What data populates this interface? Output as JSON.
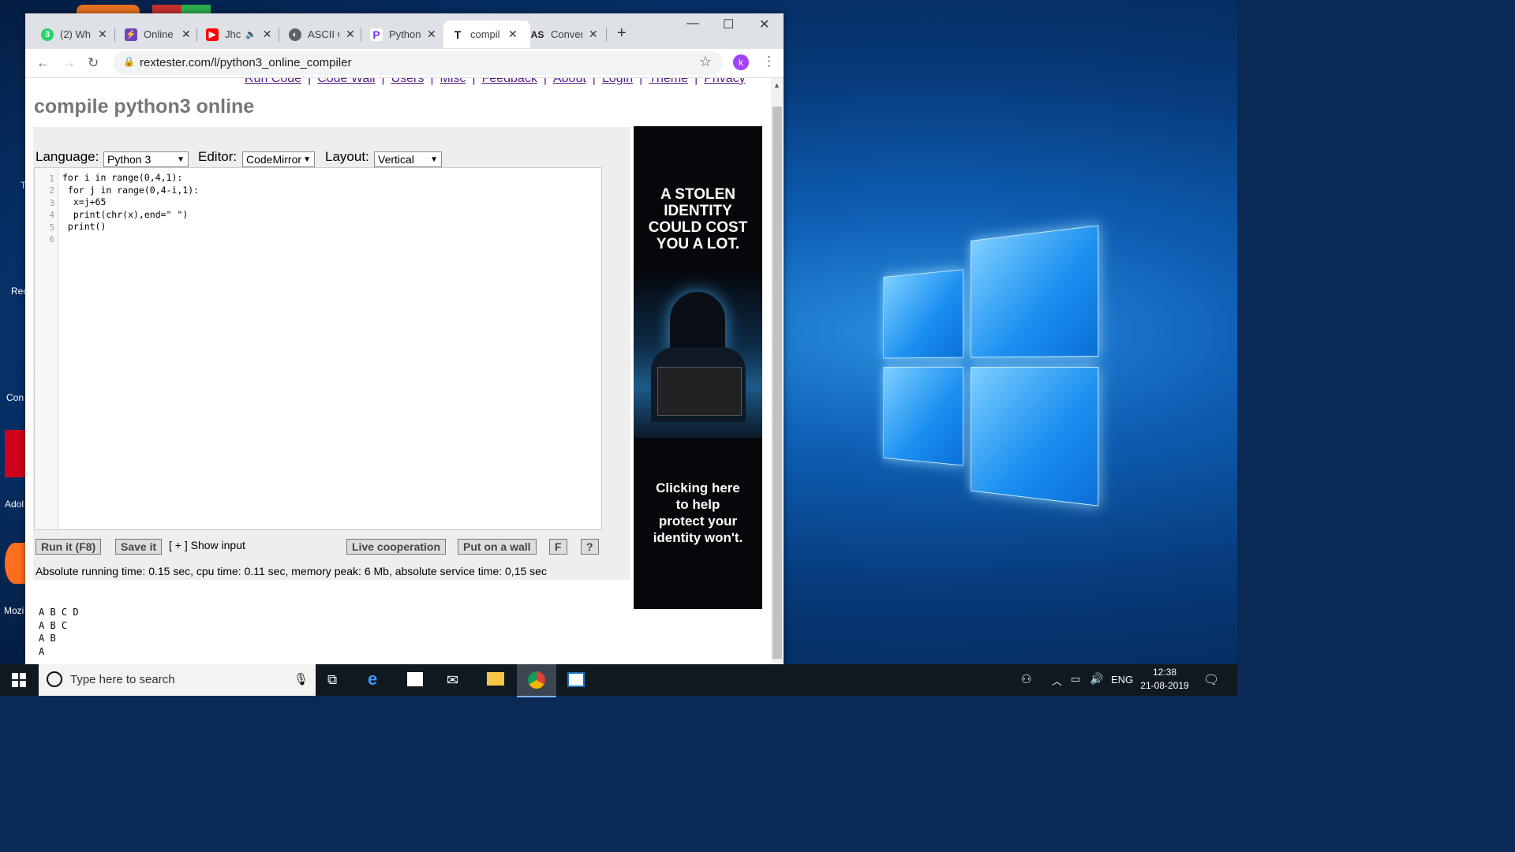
{
  "browser": {
    "tabs": [
      {
        "title": "(2) Wh",
        "icon": "whatsapp-icon",
        "color": "#25d366",
        "glyph": "3"
      },
      {
        "title": "Online",
        "icon": "lightning-icon",
        "color": "#6f42c1",
        "glyph": "⚡"
      },
      {
        "title": "Jhc",
        "icon": "youtube-icon",
        "color": "#ff0000",
        "glyph": "▶"
      },
      {
        "title": "ASCII C",
        "icon": "globe-icon",
        "color": "#5f6368",
        "glyph": "◐"
      },
      {
        "title": "Python",
        "icon": "p-icon",
        "color": "#7b2ff7",
        "glyph": "P"
      },
      {
        "title": "compil",
        "icon": "t-icon",
        "color": "#ffffff",
        "glyph": "T"
      },
      {
        "title": "Conver",
        "icon": "as-icon",
        "color": "#ffffff",
        "glyph": "AS"
      }
    ],
    "url": "rextester.com/l/python3_online_compiler",
    "profile_initial": "k"
  },
  "page": {
    "nav_links": [
      "Run Code",
      "Code Wall",
      "Users",
      "Misc",
      "Feedback",
      "About",
      "Login",
      "Theme",
      "Privacy"
    ],
    "title": "compile python3 online",
    "language_label": "Language:",
    "language_value": "Python 3",
    "editor_label": "Editor:",
    "editor_value": "CodeMirror",
    "layout_label": "Layout:",
    "layout_value": "Vertical",
    "code_lines": [
      "for i in range(0,4,1):",
      " for j in range(0,4-i,1):",
      "  x=j+65",
      "  print(chr(x),end=\" \")",
      " print()",
      ""
    ],
    "buttons": {
      "run": "Run it (F8)",
      "save": "Save it",
      "show_input": "[ + ] Show input",
      "live": "Live cooperation",
      "wall": "Put on a wall",
      "f": "F",
      "help": "?"
    },
    "stats": "Absolute running time: 0.15 sec, cpu time: 0.11 sec, memory peak: 6 Mb, absolute service time: 0,15 sec",
    "output_lines": [
      "A B C D",
      "A B C",
      "A B",
      "A"
    ],
    "ad": {
      "headline": [
        "A STOLEN",
        "IDENTITY",
        "COULD COST",
        "YOU A LOT."
      ],
      "footer": [
        "Clicking here",
        "to help",
        "protect your",
        "identity won't."
      ]
    }
  },
  "desktop": {
    "icon_labels": [
      "T",
      "Rec",
      "Con",
      "Adol",
      "Mozi"
    ]
  },
  "taskbar": {
    "search_placeholder": "Type here to search",
    "lang": "ENG",
    "time": "12:38",
    "date": "21-08-2019"
  }
}
